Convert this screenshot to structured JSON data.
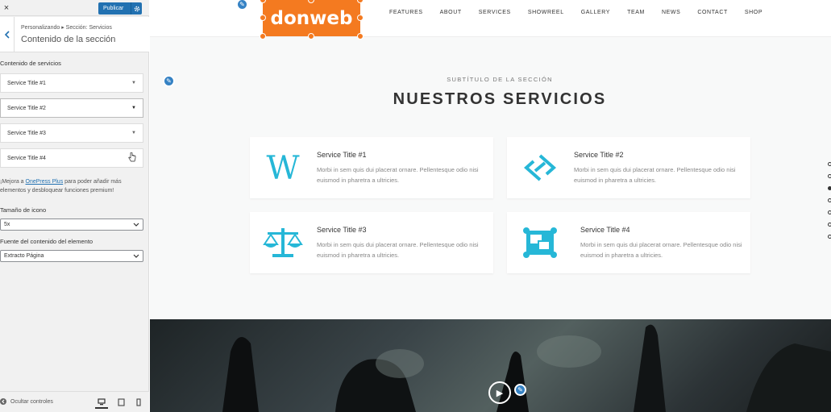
{
  "sidebar": {
    "close_icon": "×",
    "publish_label": "Publicar",
    "breadcrumb_path": "Personalizando ▸ Sección: Servicios",
    "breadcrumb_title": "Contenido de la sección",
    "section_label": "Contenido de servicios",
    "accordion": [
      {
        "label": "Service Title #1"
      },
      {
        "label": "Service Title #2"
      },
      {
        "label": "Service Title #3"
      },
      {
        "label": "Service Title #4"
      }
    ],
    "upsell_prefix": "¡Mejora a ",
    "upsell_link": "OnePress Plus",
    "upsell_suffix": " para poder añadir más elementos y desbloquear funciones premium!",
    "icon_size_label": "Tamaño de icono",
    "icon_size_value": "5x",
    "content_source_label": "Fuente del contenido del elemento",
    "content_source_value": "Extracto Página",
    "hide_controls_label": "Ocultar controles"
  },
  "preview": {
    "logo_text": "donweb",
    "nav": [
      "FEATURES",
      "ABOUT",
      "SERVICES",
      "SHOWREEL",
      "GALLERY",
      "TEAM",
      "NEWS",
      "CONTACT",
      "SHOP"
    ],
    "section_subtitle": "SUBTÍTULO DE LA SECCIÓN",
    "section_title": "NUESTROS SERVICIOS",
    "services": [
      {
        "title": "Service Title #1",
        "desc": "Morbi in sem quis dui placerat ornare. Pellentesque odio nisi euismod in pharetra a ultricies.",
        "icon": "wikipedia-icon"
      },
      {
        "title": "Service Title #2",
        "desc": "Morbi in sem quis dui placerat ornare. Pellentesque odio nisi euismod in pharetra a ultricies.",
        "icon": "link-diamond-icon"
      },
      {
        "title": "Service Title #3",
        "desc": "Morbi in sem quis dui placerat ornare. Pellentesque odio nisi euismod in pharetra a ultricies.",
        "icon": "balance-scale-icon"
      },
      {
        "title": "Service Title #4",
        "desc": "Morbi in sem quis dui placerat ornare. Pellentesque odio nisi euismod in pharetra a ultricies.",
        "icon": "object-group-icon"
      }
    ],
    "icon_color": "#26b7d7",
    "logo_color": "#f47a20"
  }
}
